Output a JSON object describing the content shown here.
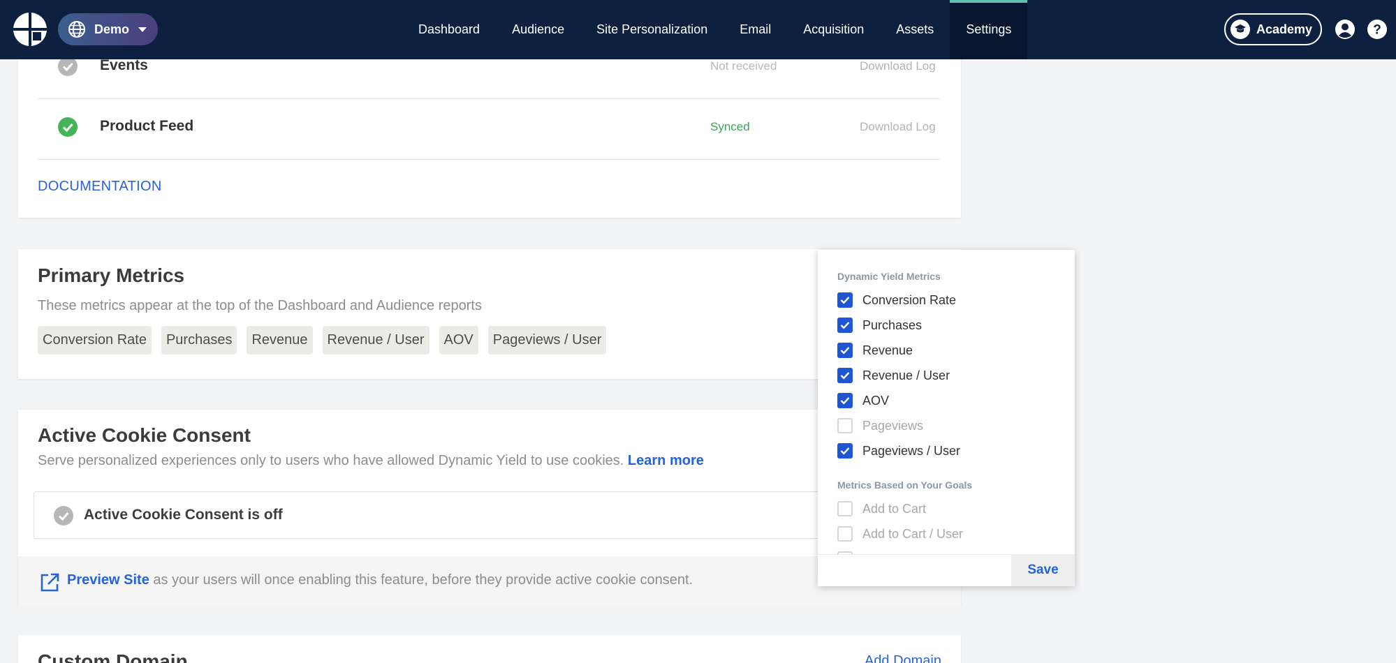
{
  "nav": {
    "site_name": "Demo",
    "links": [
      "Dashboard",
      "Audience",
      "Site Personalization",
      "Email",
      "Acquisition",
      "Assets",
      "Settings"
    ],
    "active": "Settings",
    "academy_label": "Academy",
    "icons": [
      "logo-icon",
      "globe-icon",
      "chevron-down-icon",
      "graduation-cap-icon",
      "user-icon",
      "help-icon"
    ]
  },
  "integrations": {
    "rows": [
      {
        "title": "Events",
        "status": "Not received",
        "status_color": "#b8b8b8",
        "icon_color": "#b6b6b6",
        "action": "Download Log"
      },
      {
        "title": "Product Feed",
        "status": "Synced",
        "status_color": "#3aa655",
        "icon_color": "#46b35a",
        "action": "Download Log"
      }
    ],
    "documentation_link": "DOCUMENTATION"
  },
  "primary_metrics": {
    "title": "Primary Metrics",
    "subtitle": "These metrics appear at the top of the Dashboard and Audience reports",
    "chips": [
      "Conversion Rate",
      "Purchases",
      "Revenue",
      "Revenue / User",
      "AOV",
      "Pageviews / User"
    ]
  },
  "cookie_consent": {
    "title": "Active Cookie Consent",
    "subtitle": "Serve personalized experiences only to users who have allowed Dynamic Yield to use cookies.",
    "learn_more": "Learn more",
    "status_text": "Active Cookie Consent is off",
    "preview_link": "Preview Site",
    "preview_text": "as your users will once enabling this feature, before they provide active cookie consent."
  },
  "custom_domain": {
    "title": "Custom Domain",
    "add_link": "Add Domain"
  },
  "metrics_dropdown": {
    "group1_title": "Dynamic Yield Metrics",
    "group1": [
      {
        "label": "Conversion Rate",
        "checked": true
      },
      {
        "label": "Purchases",
        "checked": true
      },
      {
        "label": "Revenue",
        "checked": true
      },
      {
        "label": "Revenue / User",
        "checked": true
      },
      {
        "label": "AOV",
        "checked": true
      },
      {
        "label": "Pageviews",
        "checked": false
      },
      {
        "label": "Pageviews / User",
        "checked": true
      }
    ],
    "group2_title": "Metrics Based on Your Goals",
    "group2": [
      {
        "label": "Add to Cart",
        "checked": false
      },
      {
        "label": "Add to Cart / User",
        "checked": false
      }
    ],
    "save_label": "Save",
    "accent_color": "#1f56d6"
  }
}
